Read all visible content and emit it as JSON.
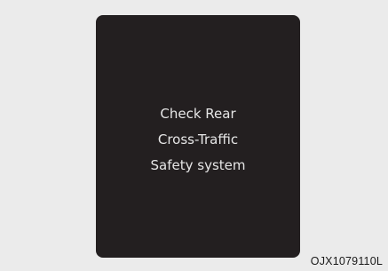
{
  "display": {
    "message_lines": [
      "Check Rear",
      "Cross-Traffic",
      "Safety system"
    ]
  },
  "figure_code": "OJX1079110L",
  "colors": {
    "background": "#ebebeb",
    "panel": "#231f20",
    "message_text": "#e6e6e6"
  }
}
